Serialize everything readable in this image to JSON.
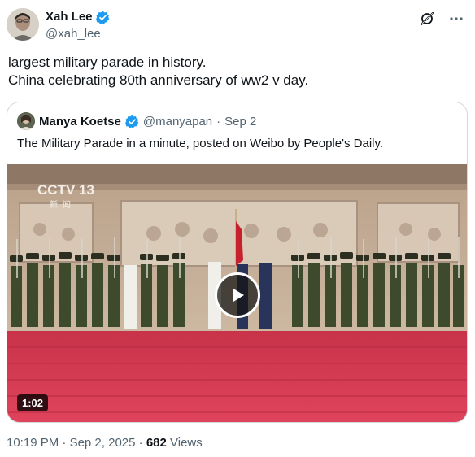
{
  "author": {
    "name": "Xah Lee",
    "handle": "@xah_lee",
    "verified": true
  },
  "tweet": {
    "lines": [
      "largest military parade in history.",
      "China celebrating 80th anniversary of ww2 v day."
    ]
  },
  "quote": {
    "name": "Manya Koetse",
    "handle": "@manyapan",
    "separator": "·",
    "date": "Sep 2",
    "text": "The Military Parade in a minute, posted on Weibo by People's Daily.",
    "video": {
      "duration": "1:02",
      "logo": "CCTV",
      "channel": "13",
      "logo_sub": "新闻"
    }
  },
  "meta": {
    "time": "10:19 PM",
    "separator": "·",
    "date": "Sep 2, 2025",
    "views_count": "682",
    "views_label": "Views"
  },
  "colors": {
    "verified_blue": "#1d9bf0",
    "muted": "#536471",
    "carpet": "#d63b52"
  },
  "icons": {
    "grok": "grok-icon",
    "more": "more-icon",
    "play": "play-icon",
    "verified": "verified-badge-icon"
  }
}
